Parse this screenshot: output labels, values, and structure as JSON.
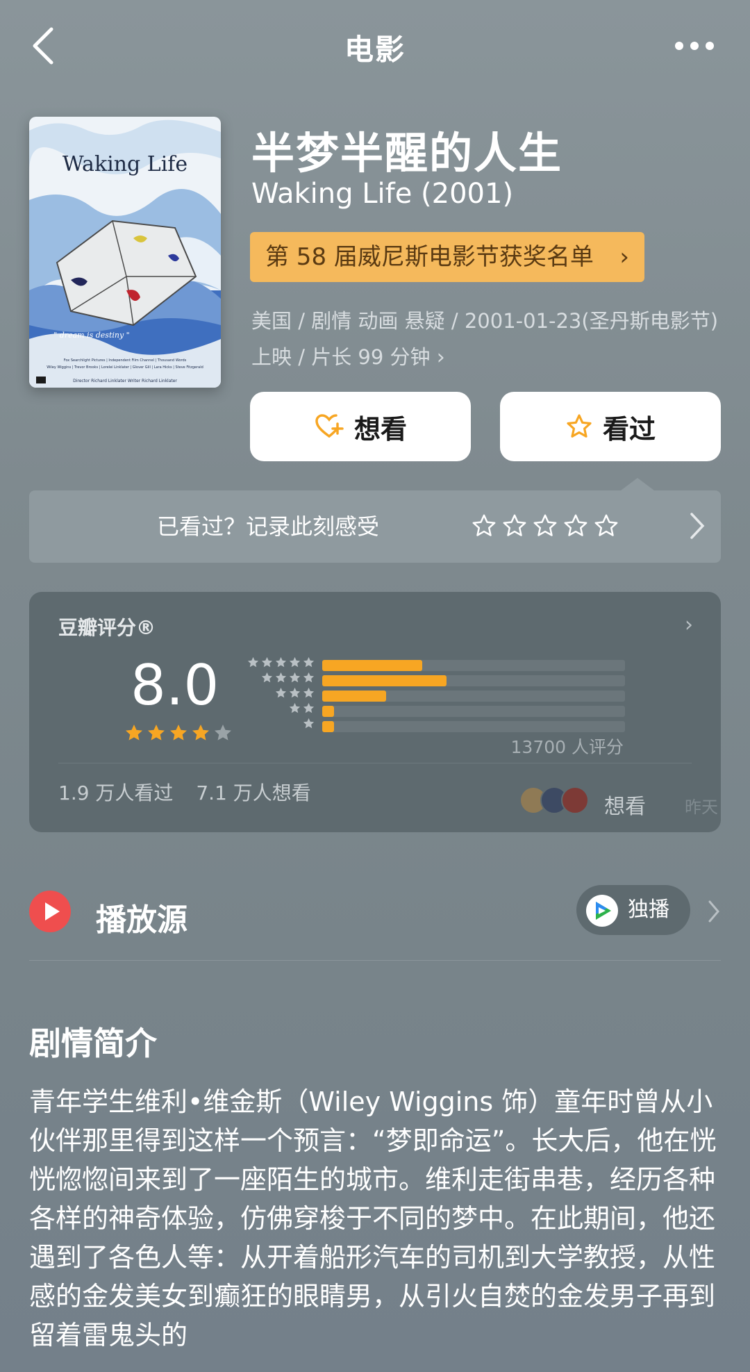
{
  "nav": {
    "title": "电影"
  },
  "movie": {
    "cn_title": "半梦半醒的人生",
    "en_title": "Waking Life (2001)",
    "award": "第 58 届威尼斯电影节获奖名单",
    "meta": "美国 / 剧情 动画 悬疑 / 2001-01-23(圣丹斯电影节) 上映 / 片长 99 分钟",
    "poster": {
      "title": "Waking Life",
      "tagline": "\" dream is destiny \"",
      "credits_line1": "Fox Searchlight Pictures | Independent Film Channel | Thousand Words",
      "credits_line2": "Wiley Wiggins | Trevor Brooks | Lorelei Linklater | Glover Gill | Lara Hicks | Steve Fitzgerald",
      "credits_line3": "Director Richard Linklater    Writer Richard Linklater"
    }
  },
  "actions": {
    "want": "想看",
    "seen": "看过"
  },
  "record": {
    "label": "已看过？记录此刻感受",
    "stars": 5
  },
  "rating": {
    "label": "豆瓣评分®",
    "score": "8.0",
    "stars_filled": 4,
    "stars_total": 5,
    "distribution": [
      {
        "stars": 5,
        "fraction": 0.33
      },
      {
        "stars": 4,
        "fraction": 0.41
      },
      {
        "stars": 3,
        "fraction": 0.21
      },
      {
        "stars": 2,
        "fraction": 0.04
      },
      {
        "stars": 1,
        "fraction": 0.04
      }
    ],
    "count": "13700 人评分",
    "seen": "1.9 万人看过",
    "want": "7.1 万人想看",
    "friend_action": "想看",
    "friend_time": "昨天"
  },
  "source": {
    "label": "播放源",
    "platform": "独播"
  },
  "synopsis": {
    "title": "剧情简介",
    "text": "青年学生维利•维金斯（Wiley Wiggins 饰）童年时曾从小伙伴那里得到这样一个预言：“梦即命运”。长大后，他在恍恍惚惚间来到了一座陌生的城市。维利走街串巷，经历各种各样的神奇体验，仿佛穿梭于不同的梦中。在此期间，他还遇到了各色人等：从开着船形汽车的司机到大学教授，从性感的金发美女到癫狂的眼睛男，从引火自焚的金发男子再到留着雷鬼头的"
  },
  "colors": {
    "accent": "#f7a623",
    "award_bg": "#f5b95c",
    "play": "#ef4e4e"
  }
}
